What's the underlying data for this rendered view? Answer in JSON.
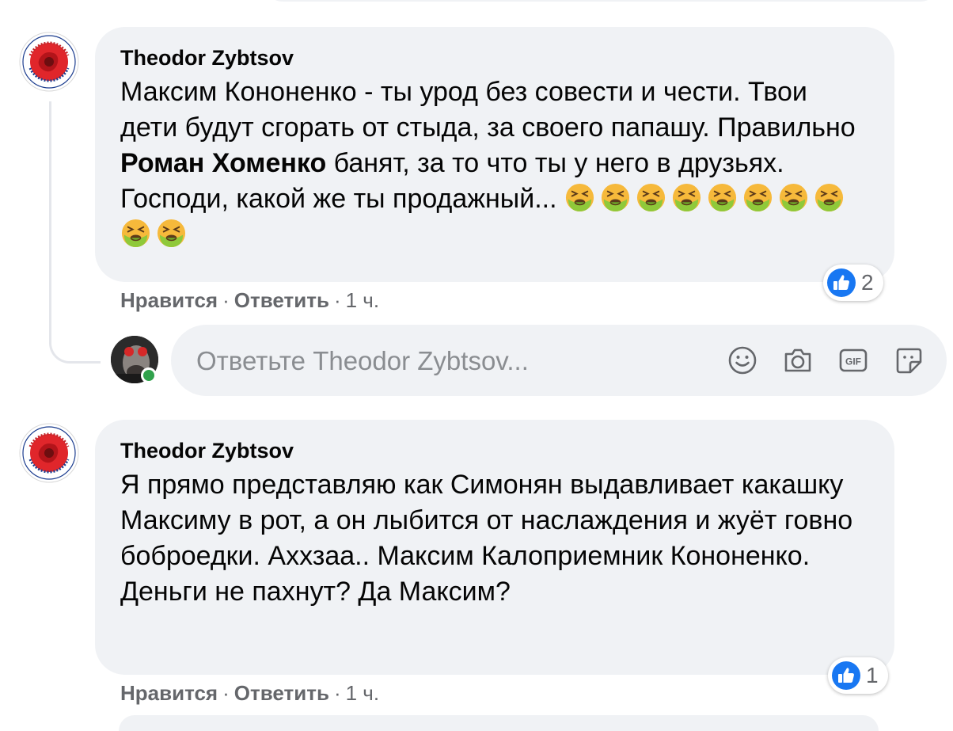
{
  "comments": [
    {
      "author": "Theodor Zybtsov",
      "text_segments": [
        {
          "text": "Максим Кононенко - ты урод без совести и чести. Твои дети будут сгорать от стыда, за своего папашу. Правильно ",
          "bold": false
        },
        {
          "text": "Роман Хоменко",
          "bold": true
        },
        {
          "text": " банят, за то что ты у него в друзьях. Господи, какой же ты продажный... ",
          "bold": false
        }
      ],
      "emoji_name": "nauseated-face-icon",
      "emoji_count": 10,
      "reactions": {
        "icon": "like-icon",
        "count": "2"
      },
      "actions": {
        "like": "Нравится",
        "reply": "Ответить",
        "time": "1 ч."
      }
    },
    {
      "author": "Theodor Zybtsov",
      "text_segments": [
        {
          "text": "Я прямо представляю как Симонян выдавливает какашку Максиму в рот, а он лыбится от наслаждения и жуёт говно боброедки. Аххзаа.. Максим Калоприемник Кононенко. Деньги не пахнут? Да Максим?",
          "bold": false
        }
      ],
      "reactions": {
        "icon": "like-icon",
        "count": "1"
      },
      "actions": {
        "like": "Нравится",
        "reply": "Ответить",
        "time": "1 ч."
      }
    }
  ],
  "reply_box": {
    "placeholder": "Ответьте Theodor Zybtsov...",
    "icons": [
      "emoji-icon",
      "camera-icon",
      "gif-icon",
      "sticker-icon"
    ]
  },
  "colors": {
    "bubble": "#f0f2f5",
    "meta_text": "#65676b",
    "like_blue": "#1877f2",
    "online": "#31a24c"
  }
}
